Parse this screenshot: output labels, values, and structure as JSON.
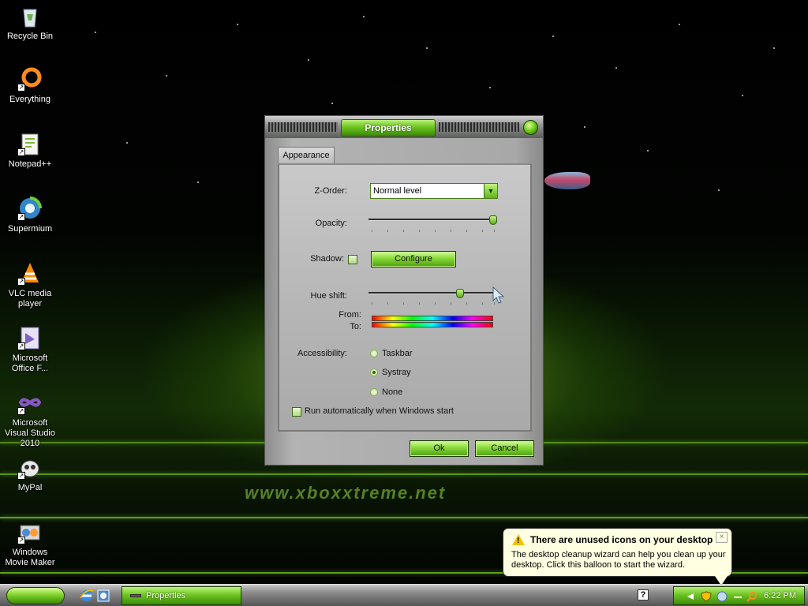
{
  "desktop": {
    "watermark": "www.xboxxtreme.net",
    "icons": [
      {
        "label": "Recycle Bin",
        "icon": "recycle-bin-icon"
      },
      {
        "label": "Everything",
        "icon": "everything-icon"
      },
      {
        "label": "Notepad++",
        "icon": "notepad-plus-plus-icon"
      },
      {
        "label": "Supermium",
        "icon": "supermium-icon"
      },
      {
        "label": "VLC media player",
        "icon": "vlc-icon"
      },
      {
        "label": "Microsoft Office F...",
        "icon": "office-icon"
      },
      {
        "label": "Microsoft Visual Studio 2010",
        "icon": "visual-studio-icon"
      },
      {
        "label": "MyPal",
        "icon": "mypal-icon"
      },
      {
        "label": "Windows Movie Maker",
        "icon": "movie-maker-icon"
      }
    ]
  },
  "dialog": {
    "title": "Properties",
    "tab": "Appearance",
    "zorder": {
      "label": "Z-Order:",
      "value": "Normal level"
    },
    "opacity": {
      "label": "Opacity:",
      "level_percent": 100
    },
    "shadow": {
      "label": "Shadow:",
      "checked": false,
      "configure_label": "Configure"
    },
    "hue_shift": {
      "label": "Hue shift:",
      "level_percent": 72,
      "from_label": "From:",
      "to_label": "To:"
    },
    "accessibility": {
      "label": "Accessibility:",
      "options": [
        {
          "label": "Taskbar",
          "selected": false
        },
        {
          "label": "Systray",
          "selected": true
        },
        {
          "label": "None",
          "selected": false
        }
      ]
    },
    "autorun_label": "Run automatically when Windows start",
    "ok_label": "Ok",
    "cancel_label": "Cancel"
  },
  "balloon": {
    "title": "There are unused icons on your desktop",
    "body": "The desktop cleanup wizard can help you clean up your desktop. Click this balloon to start the wizard.",
    "close": "×"
  },
  "taskbar": {
    "task_properties": "Properties",
    "help_icon": "?",
    "clock": "6:22 PM"
  },
  "colors": {
    "accent_green": "#6fc623",
    "balloon_bg": "#ffffe1"
  }
}
